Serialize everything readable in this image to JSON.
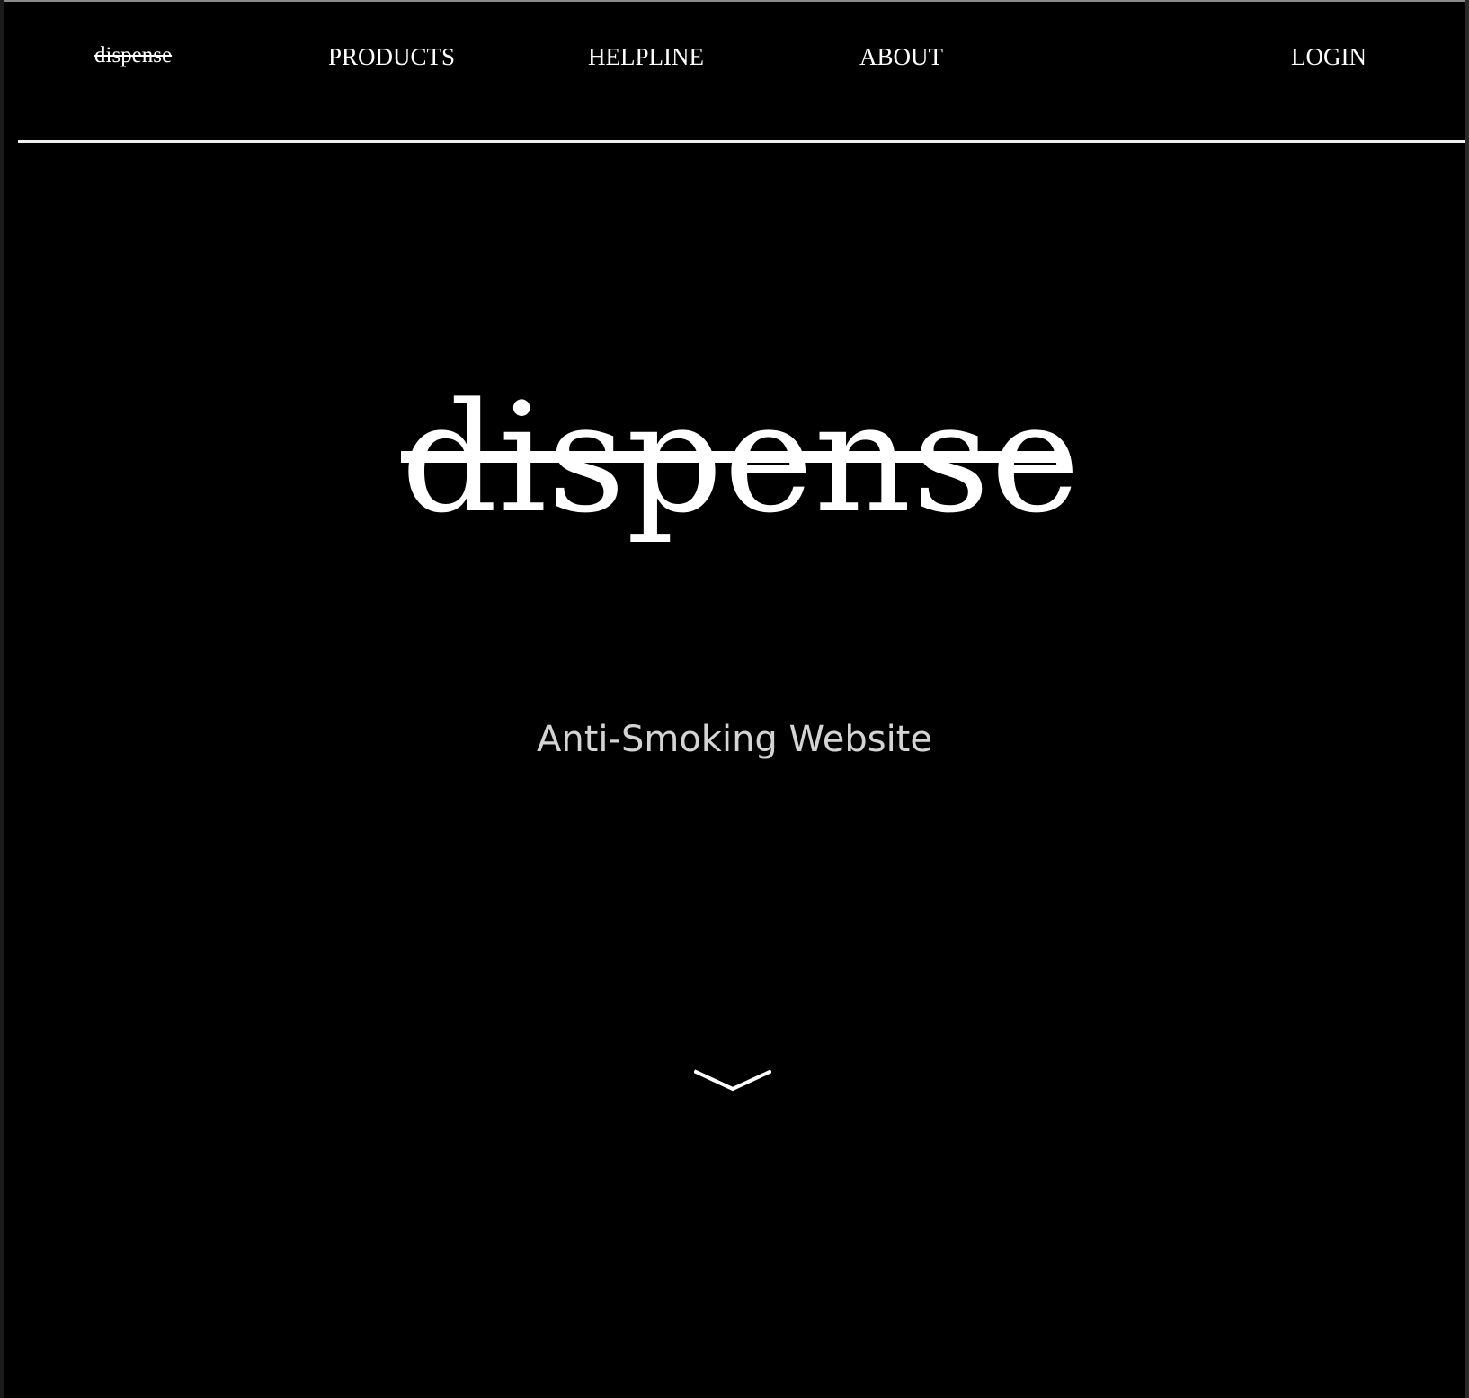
{
  "nav": {
    "brand": "dispense",
    "products": "PRODUCTS",
    "helpline": "HELPLINE",
    "about": "ABOUT",
    "login": "LOGIN"
  },
  "hero": {
    "logo_text": "dispense",
    "subtitle": "Anti-Smoking Website",
    "scroll_icon": "chevron-down-icon"
  },
  "colors": {
    "background": "#000000",
    "text": "#ffffff",
    "subtitle": "#d4d4d4",
    "divider": "#f0f0f0"
  }
}
